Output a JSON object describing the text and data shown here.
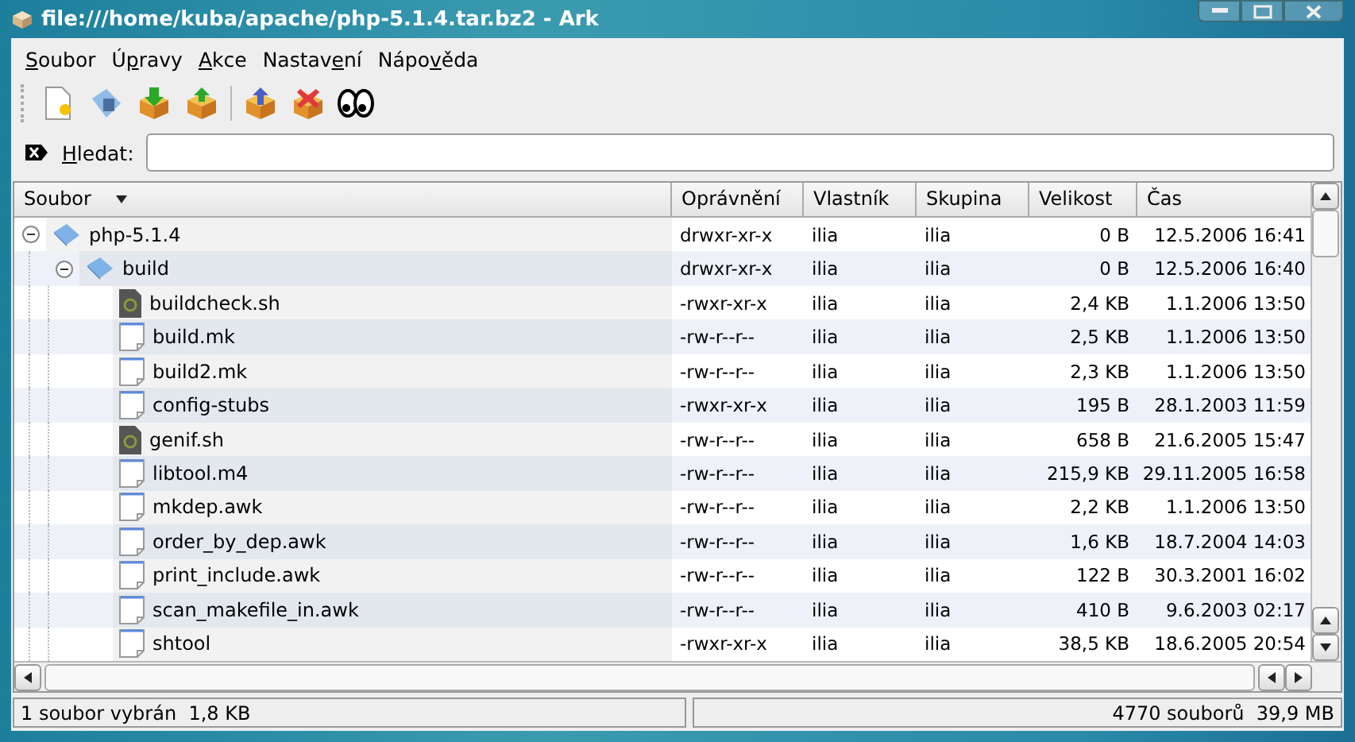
{
  "window": {
    "title": "file:///home/kuba/apache/php-5.1.4.tar.bz2 - Ark"
  },
  "menu": [
    {
      "key": "S",
      "post": "oubor"
    },
    {
      "pre": "Ú",
      "key": "p",
      "post": "ravy"
    },
    {
      "key": "A",
      "post": "kce"
    },
    {
      "pre": "Nastav",
      "key": "e",
      "post": "ní"
    },
    {
      "pre": "Nápo",
      "key": "v",
      "post": "ěda"
    }
  ],
  "search": {
    "label": {
      "key": "H",
      "post": "ledat:"
    }
  },
  "table": {
    "columns": [
      {
        "label": "Soubor",
        "sorted": true
      },
      {
        "label": "Oprávnění",
        "sorted": false
      },
      {
        "label": "Vlastník",
        "sorted": false
      },
      {
        "label": "Skupina",
        "sorted": false
      },
      {
        "label": "Velikost",
        "sorted": false
      },
      {
        "label": "Čas",
        "sorted": false
      }
    ],
    "rows": [
      {
        "name": "php-5.1.4",
        "kind": "folder",
        "expanded": true,
        "permissions": "drwxr-xr-x",
        "owner": "ilia",
        "group": "ilia",
        "size": "0 B",
        "time": "12.5.2006 16:41",
        "children": [
          {
            "name": "build",
            "kind": "folder",
            "expanded": true,
            "permissions": "drwxr-xr-x",
            "owner": "ilia",
            "group": "ilia",
            "size": "0 B",
            "time": "12.5.2006 16:40",
            "children": [
              {
                "name": "buildcheck.sh",
                "kind": "script",
                "permissions": "-rwxr-xr-x",
                "owner": "ilia",
                "group": "ilia",
                "size": "2,4 KB",
                "time": "1.1.2006 13:50"
              },
              {
                "name": "build.mk",
                "kind": "text",
                "permissions": "-rw-r--r--",
                "owner": "ilia",
                "group": "ilia",
                "size": "2,5 KB",
                "time": "1.1.2006 13:50"
              },
              {
                "name": "build2.mk",
                "kind": "text",
                "permissions": "-rw-r--r--",
                "owner": "ilia",
                "group": "ilia",
                "size": "2,3 KB",
                "time": "1.1.2006 13:50"
              },
              {
                "name": "config-stubs",
                "kind": "text",
                "permissions": "-rwxr-xr-x",
                "owner": "ilia",
                "group": "ilia",
                "size": "195 B",
                "time": "28.1.2003 11:59"
              },
              {
                "name": "genif.sh",
                "kind": "script",
                "permissions": "-rw-r--r--",
                "owner": "ilia",
                "group": "ilia",
                "size": "658 B",
                "time": "21.6.2005 15:47"
              },
              {
                "name": "libtool.m4",
                "kind": "text",
                "permissions": "-rw-r--r--",
                "owner": "ilia",
                "group": "ilia",
                "size": "215,9 KB",
                "time": "29.11.2005 16:58"
              },
              {
                "name": "mkdep.awk",
                "kind": "text",
                "permissions": "-rw-r--r--",
                "owner": "ilia",
                "group": "ilia",
                "size": "2,2 KB",
                "time": "1.1.2006 13:50"
              },
              {
                "name": "order_by_dep.awk",
                "kind": "text",
                "permissions": "-rw-r--r--",
                "owner": "ilia",
                "group": "ilia",
                "size": "1,6 KB",
                "time": "18.7.2004 14:03"
              },
              {
                "name": "print_include.awk",
                "kind": "text",
                "permissions": "-rw-r--r--",
                "owner": "ilia",
                "group": "ilia",
                "size": "122 B",
                "time": "30.3.2001 16:02"
              },
              {
                "name": "scan_makefile_in.awk",
                "kind": "text",
                "permissions": "-rw-r--r--",
                "owner": "ilia",
                "group": "ilia",
                "size": "410 B",
                "time": "9.6.2003 02:17"
              },
              {
                "name": "shtool",
                "kind": "text",
                "permissions": "-rwxr-xr-x",
                "owner": "ilia",
                "group": "ilia",
                "size": "38,5 KB",
                "time": "18.6.2005 20:54"
              }
            ]
          }
        ]
      }
    ]
  },
  "status_bar": {
    "selection": "1 soubor vybrán  1,8 KB",
    "summary": "4770 souborů  39,9 MB"
  }
}
